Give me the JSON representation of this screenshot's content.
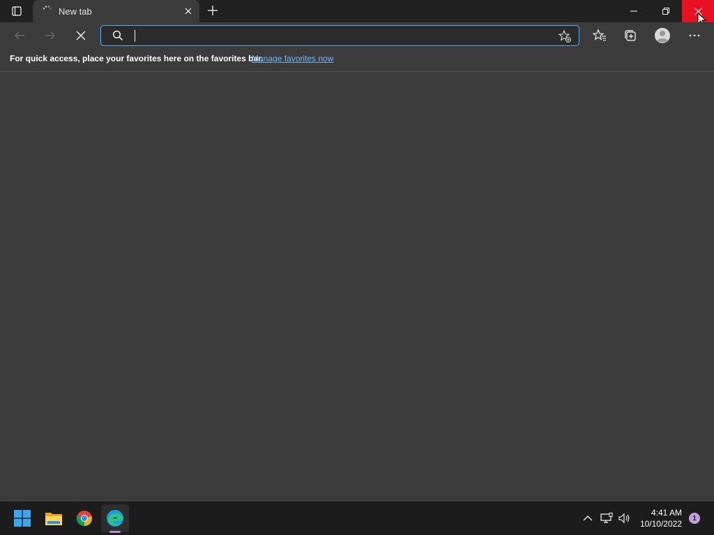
{
  "browser": {
    "tab": {
      "title": "New tab",
      "loading": true
    },
    "address_bar": {
      "value": "",
      "placeholder": ""
    },
    "favorites_bar": {
      "message": "For quick access, place your favorites here on the favorites bar.",
      "link": "Manage favorites now"
    },
    "icons": {
      "tab_actions": "tab-actions-icon",
      "back": "back-arrow-icon",
      "forward": "forward-arrow-icon",
      "stop": "stop-loading-icon",
      "search": "search-icon",
      "add_favorite": "add-favorite-icon",
      "favorites": "favorites-icon",
      "collections": "collections-icon",
      "profile": "profile-icon",
      "more": "more-icon"
    },
    "window_controls": [
      "minimize",
      "restore",
      "close"
    ]
  },
  "taskbar": {
    "apps": [
      "Start",
      "File Explorer",
      "Google Chrome",
      "Microsoft Edge"
    ],
    "active_app": "Microsoft Edge",
    "clock": {
      "time": "4:41 AM",
      "date": "10/10/2022"
    },
    "notification_count": "1"
  },
  "colors": {
    "accent": "#60aff0",
    "link": "#73b8f5",
    "close_hover": "#e81123",
    "page_bg": "#3b3b3b",
    "titlebar_bg": "#202020",
    "taskbar_bg": "#1c1c1c",
    "badge": "#c39ee0"
  }
}
